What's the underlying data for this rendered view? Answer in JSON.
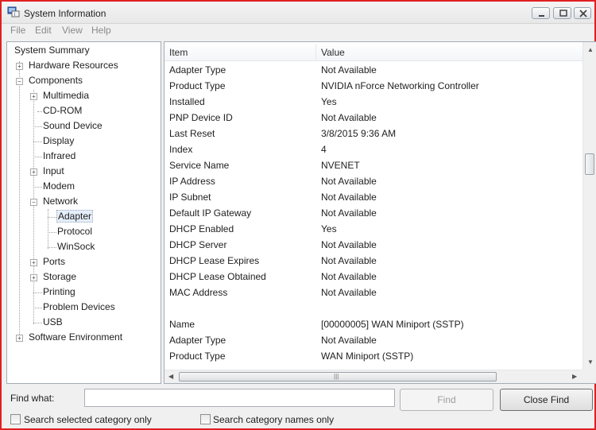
{
  "window": {
    "title": "System Information"
  },
  "menu": [
    "File",
    "Edit",
    "View",
    "Help"
  ],
  "tree": {
    "root": "System Summary",
    "hardware": "Hardware Resources",
    "components": "Components",
    "multimedia": "Multimedia",
    "cdrom": "CD-ROM",
    "sound": "Sound Device",
    "display": "Display",
    "infrared": "Infrared",
    "input": "Input",
    "modem": "Modem",
    "network": "Network",
    "adapter": "Adapter",
    "protocol": "Protocol",
    "winsock": "WinSock",
    "ports": "Ports",
    "storage": "Storage",
    "printing": "Printing",
    "problem": "Problem Devices",
    "usb": "USB",
    "software": "Software Environment"
  },
  "details": {
    "columns": {
      "item": "Item",
      "value": "Value"
    },
    "rows": [
      {
        "item": "Adapter Type",
        "value": "Not Available"
      },
      {
        "item": "Product Type",
        "value": "NVIDIA nForce Networking Controller"
      },
      {
        "item": "Installed",
        "value": "Yes"
      },
      {
        "item": "PNP Device ID",
        "value": "Not Available"
      },
      {
        "item": "Last Reset",
        "value": "3/8/2015 9:36 AM"
      },
      {
        "item": "Index",
        "value": "4"
      },
      {
        "item": "Service Name",
        "value": "NVENET"
      },
      {
        "item": "IP Address",
        "value": "Not Available"
      },
      {
        "item": "IP Subnet",
        "value": "Not Available"
      },
      {
        "item": "Default IP Gateway",
        "value": "Not Available"
      },
      {
        "item": "DHCP Enabled",
        "value": "Yes"
      },
      {
        "item": "DHCP Server",
        "value": "Not Available"
      },
      {
        "item": "DHCP Lease Expires",
        "value": "Not Available"
      },
      {
        "item": "DHCP Lease Obtained",
        "value": "Not Available"
      },
      {
        "item": "MAC Address",
        "value": "Not Available"
      },
      {
        "item": "",
        "value": ""
      },
      {
        "item": "Name",
        "value": "[00000005] WAN Miniport (SSTP)"
      },
      {
        "item": "Adapter Type",
        "value": "Not Available"
      },
      {
        "item": "Product Type",
        "value": "WAN Miniport (SSTP)"
      }
    ]
  },
  "find": {
    "label": "Find what:",
    "value": "",
    "find_button": "Find",
    "close_button": "Close Find",
    "opt1": "Search selected category only",
    "opt2": "Search category names only"
  }
}
